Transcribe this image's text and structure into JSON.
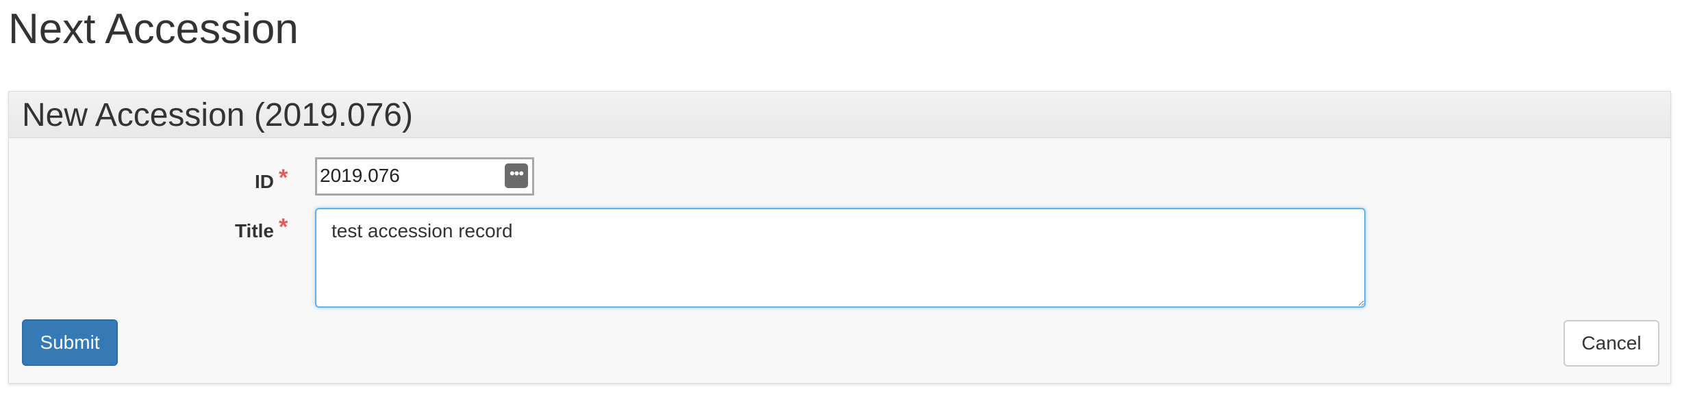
{
  "page": {
    "title": "Next Accession"
  },
  "panel": {
    "title": "New Accession (2019.076)"
  },
  "form": {
    "id_label": "ID",
    "id_value": "2019.076",
    "title_label": "Title",
    "title_value": "test accession record",
    "required_marker": "*",
    "more_icon": "•••"
  },
  "actions": {
    "submit_label": "Submit",
    "cancel_label": "Cancel"
  },
  "colors": {
    "primary": "#337ab7",
    "required": "#e05a5a",
    "focus": "#66afe9"
  }
}
